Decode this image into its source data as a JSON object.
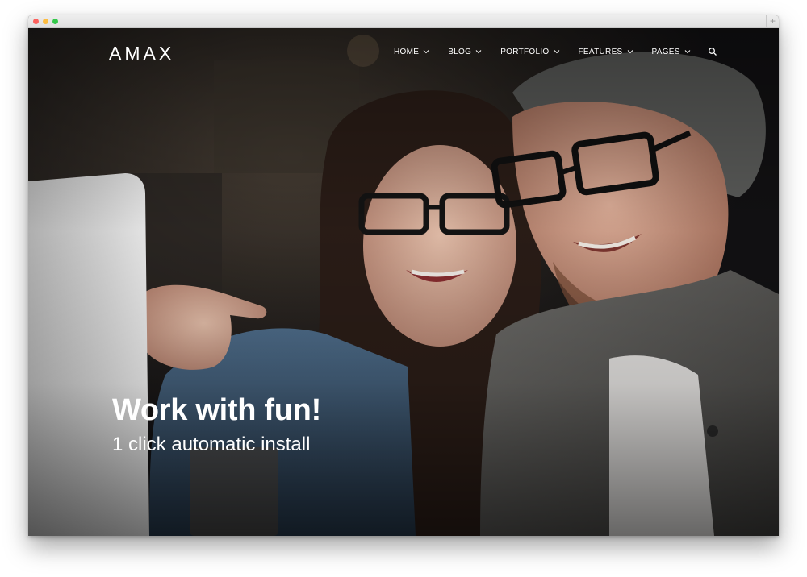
{
  "browser": {
    "new_tab_glyph": "+"
  },
  "site": {
    "logo": "AMAX",
    "nav": {
      "items": [
        {
          "label": "HOME",
          "icon": "chevron-down-icon"
        },
        {
          "label": "BLOG",
          "icon": "chevron-down-icon"
        },
        {
          "label": "PORTFOLIO",
          "icon": "chevron-down-icon"
        },
        {
          "label": "FEATURES",
          "icon": "chevron-down-icon"
        },
        {
          "label": "PAGES",
          "icon": "chevron-down-icon"
        }
      ],
      "search_icon": "search-icon"
    }
  },
  "hero": {
    "title": "Work with fun!",
    "subtitle": "1 click automatic install",
    "image": "photo of a woman and a man wearing glasses smiling at a screen"
  },
  "colors": {
    "window_close": "#fc605c",
    "window_minimize": "#fdbc40",
    "window_zoom": "#34c84a",
    "text": "#ffffff"
  }
}
